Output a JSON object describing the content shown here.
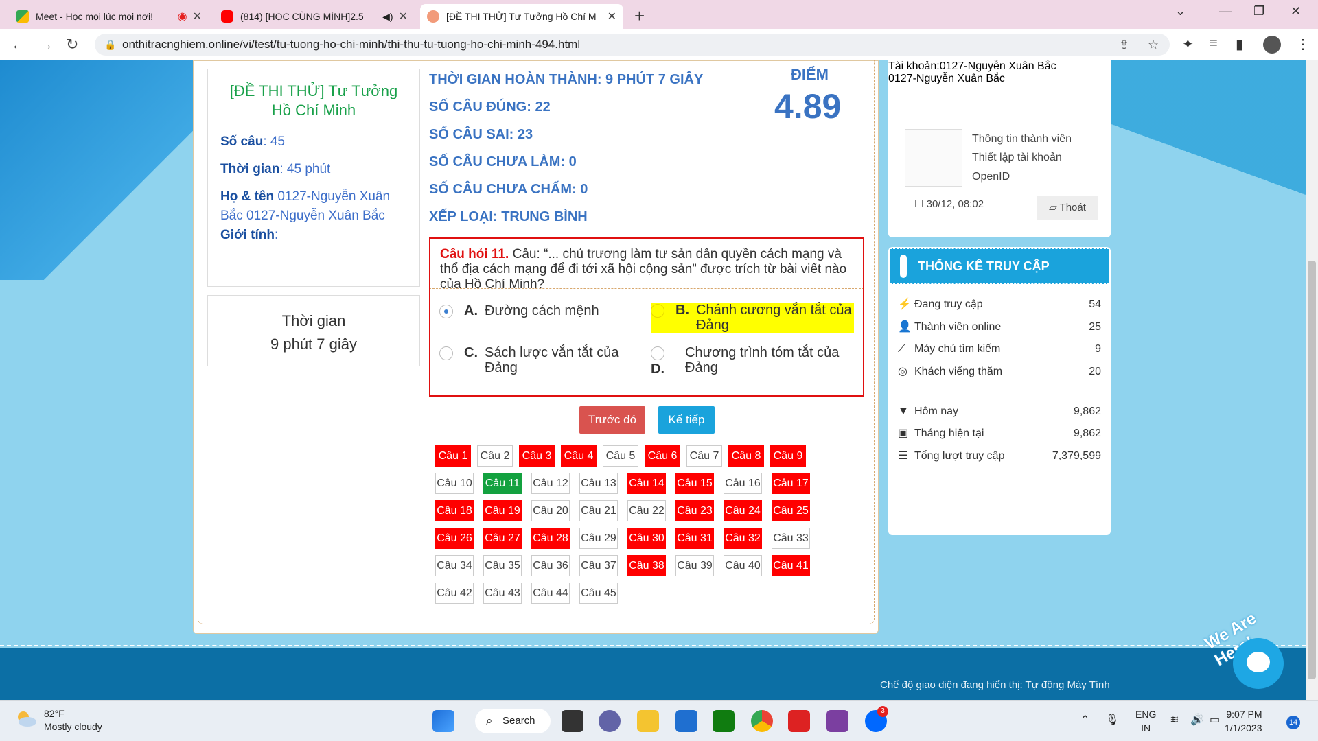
{
  "browser": {
    "tabs": [
      {
        "title": "Meet - Học mọi lúc mọi nơi!",
        "close": "✕"
      },
      {
        "title": "(814) [HỌC CÙNG MÌNH]2.5",
        "close": "✕"
      },
      {
        "title": "[ĐỀ THI THỬ] Tư Tưởng Hồ Chí M",
        "close": "✕"
      }
    ],
    "url": "onthitracnghiem.online/vi/test/tu-tuong-ho-chi-minh/thi-thu-tu-tuong-ho-chi-minh-494.html"
  },
  "test_info": {
    "title": "[ĐỀ THI THỬ] Tư Tưởng Hồ Chí Minh",
    "questions_label": "Số câu",
    "questions_value": ": 45",
    "time_label": "Thời gian",
    "time_value": ": 45 phút",
    "name_label": "Họ & tên",
    "name_value": " 0127-Nguyễn Xuân Bắc 0127-Nguyễn Xuân Bắc",
    "gender_label": "Giới tính",
    "gender_value": ":"
  },
  "elapsed": {
    "label": "Thời gian",
    "value": "9 phút 7 giây"
  },
  "results": {
    "lines": [
      "THỜI GIAN HOÀN THÀNH: 9 PHÚT 7 GIÂY",
      "SỐ CÂU ĐÚNG: 22",
      "SỐ CÂU SAI: 23",
      "SỐ CÂU CHƯA LÀM: 0",
      "SỐ CÂU CHƯA CHẤM: 0",
      "XẾP LOẠI: TRUNG BÌNH"
    ],
    "score_label": "ĐIỂM",
    "score": "4.89"
  },
  "question": {
    "number": "Câu hỏi 11.",
    "text": " Câu: “... chủ trương làm tư sản dân quyền cách mạng và thổ địa cách mạng để đi tới xã hội cộng sản” được trích từ bài viết nào của Hồ Chí Minh?",
    "options": [
      {
        "letter": "A.",
        "text": "Đường cách mệnh"
      },
      {
        "letter": "B.",
        "text": "Chánh cương vắn tắt của Đảng"
      },
      {
        "letter": "C.",
        "text": "Sách lược vắn tắt của Đảng"
      },
      {
        "letter": "D.",
        "text": "Chương trình tóm tắt của Đảng"
      }
    ]
  },
  "buttons": {
    "prev": "Trước đó",
    "next": "Kế tiếp"
  },
  "question_grid": [
    {
      "label": "Câu 1",
      "state": "wrong"
    },
    {
      "label": "Câu 2",
      "state": "normal"
    },
    {
      "label": "Câu 3",
      "state": "wrong"
    },
    {
      "label": "Câu 4",
      "state": "wrong"
    },
    {
      "label": "Câu 5",
      "state": "normal"
    },
    {
      "label": "Câu 6",
      "state": "wrong"
    },
    {
      "label": "Câu 7",
      "state": "normal"
    },
    {
      "label": "Câu 8",
      "state": "wrong"
    },
    {
      "label": "Câu 9",
      "state": "wrong"
    },
    {
      "label": "Câu 10",
      "state": "normal"
    },
    {
      "label": "Câu 11",
      "state": "current"
    },
    {
      "label": "Câu 12",
      "state": "normal"
    },
    {
      "label": "Câu 13",
      "state": "normal"
    },
    {
      "label": "Câu 14",
      "state": "wrong"
    },
    {
      "label": "Câu 15",
      "state": "wrong"
    },
    {
      "label": "Câu 16",
      "state": "normal"
    },
    {
      "label": "Câu 17",
      "state": "wrong"
    },
    {
      "label": "Câu 18",
      "state": "wrong"
    },
    {
      "label": "Câu 19",
      "state": "wrong"
    },
    {
      "label": "Câu 20",
      "state": "normal"
    },
    {
      "label": "Câu 21",
      "state": "normal"
    },
    {
      "label": "Câu 22",
      "state": "normal"
    },
    {
      "label": "Câu 23",
      "state": "wrong"
    },
    {
      "label": "Câu 24",
      "state": "wrong"
    },
    {
      "label": "Câu 25",
      "state": "wrong"
    },
    {
      "label": "Câu 26",
      "state": "wrong"
    },
    {
      "label": "Câu 27",
      "state": "wrong"
    },
    {
      "label": "Câu 28",
      "state": "wrong"
    },
    {
      "label": "Câu 29",
      "state": "normal"
    },
    {
      "label": "Câu 30",
      "state": "wrong"
    },
    {
      "label": "Câu 31",
      "state": "wrong"
    },
    {
      "label": "Câu 32",
      "state": "wrong"
    },
    {
      "label": "Câu 33",
      "state": "normal"
    },
    {
      "label": "Câu 34",
      "state": "normal"
    },
    {
      "label": "Câu 35",
      "state": "normal"
    },
    {
      "label": "Câu 36",
      "state": "normal"
    },
    {
      "label": "Câu 37",
      "state": "normal"
    },
    {
      "label": "Câu 38",
      "state": "wrong"
    },
    {
      "label": "Câu 39",
      "state": "normal"
    },
    {
      "label": "Câu 40",
      "state": "normal"
    },
    {
      "label": "Câu 41",
      "state": "wrong"
    },
    {
      "label": "Câu 42",
      "state": "normal"
    },
    {
      "label": "Câu 43",
      "state": "normal"
    },
    {
      "label": "Câu 44",
      "state": "normal"
    },
    {
      "label": "Câu 45",
      "state": "normal"
    }
  ],
  "account": {
    "line1": "Tài khoản:0127-Nguyễn Xuân Bắc",
    "line2": "0127-Nguyễn Xuân Bắc",
    "links": [
      "Thông tin thành viên",
      "Thiết lập tài khoản",
      "OpenID"
    ],
    "date": "30/12, 08:02",
    "logout": "Thoát"
  },
  "stats": {
    "heading": "THỐNG KÊ TRUY CẬP",
    "online": [
      {
        "icon": "bolt-icon",
        "label": "Đang truy cập",
        "value": "54"
      },
      {
        "icon": "user-icon",
        "label": "Thành viên online",
        "value": "25"
      },
      {
        "icon": "wand-icon",
        "label": "Máy chủ tìm kiếm",
        "value": "9"
      },
      {
        "icon": "target-icon",
        "label": "Khách viếng thăm",
        "value": "20"
      }
    ],
    "totals": [
      {
        "icon": "filter-icon",
        "label": "Hôm nay",
        "value": "9,862"
      },
      {
        "icon": "calendar-icon",
        "label": "Tháng hiện tại",
        "value": "9,862"
      },
      {
        "icon": "list-icon",
        "label": "Tổng lượt truy cập",
        "value": "7,379,599"
      }
    ]
  },
  "footer": {
    "text": "Chế độ giao diện đang hiển thị: Tự động Máy Tính",
    "chat_badge": "We Are Here!"
  },
  "taskbar": {
    "temp": "82°F",
    "weather": "Mostly cloudy",
    "search": "Search",
    "lang1": "ENG",
    "lang2": "IN",
    "time": "9:07 PM",
    "date": "1/1/2023",
    "notif": "14",
    "zalo_badge": "3"
  },
  "colors": {
    "wrong": "#ff0000",
    "current": "#13a13f",
    "accent": "#3a73c2",
    "highlight": "#ffff00"
  }
}
